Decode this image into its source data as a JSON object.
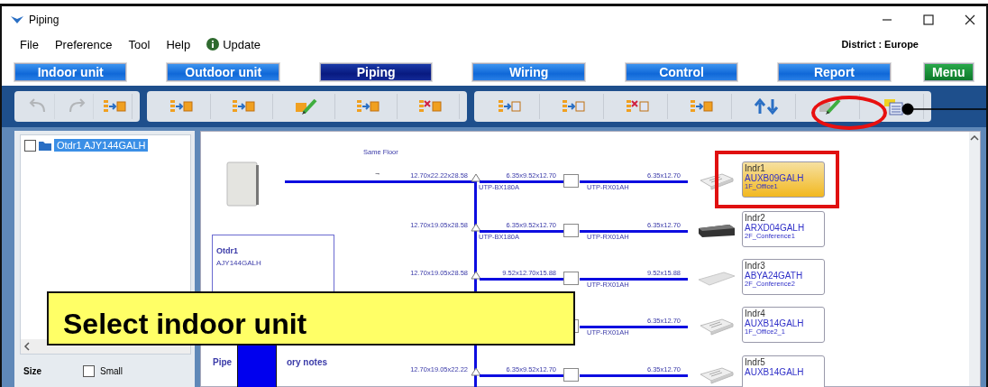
{
  "window": {
    "title": "Piping"
  },
  "menu": [
    "File",
    "Preference",
    "Tool",
    "Help"
  ],
  "update_link": "Update",
  "district": "District : Europe",
  "tabs": [
    {
      "label": "Indoor unit",
      "selected": false,
      "kind": "nav"
    },
    {
      "label": "Outdoor unit",
      "selected": false,
      "kind": "nav"
    },
    {
      "label": "Piping",
      "selected": true,
      "kind": "nav"
    },
    {
      "label": "Wiring",
      "selected": false,
      "kind": "nav"
    },
    {
      "label": "Control",
      "selected": false,
      "kind": "nav"
    },
    {
      "label": "Report",
      "selected": false,
      "kind": "nav"
    },
    {
      "label": "Menu",
      "selected": false,
      "kind": "menu"
    }
  ],
  "toolbar_groups": [
    [
      {
        "kind": "undo",
        "disabled": true
      },
      {
        "kind": "redo",
        "disabled": true
      },
      {
        "kind": "exchange",
        "disabled": false
      }
    ],
    [
      {
        "kind": "add-unit",
        "disabled": false
      },
      {
        "kind": "add-block",
        "disabled": false
      },
      {
        "kind": "edit",
        "disabled": false
      },
      {
        "kind": "swap",
        "disabled": false
      },
      {
        "kind": "delete",
        "disabled": false
      }
    ],
    [
      {
        "kind": "add-list",
        "disabled": false
      },
      {
        "kind": "insert",
        "disabled": false
      },
      {
        "kind": "delete-list",
        "disabled": false
      },
      {
        "kind": "move",
        "disabled": false
      },
      {
        "kind": "up-down",
        "disabled": false
      },
      {
        "kind": "edit-note",
        "disabled": false
      },
      {
        "kind": "list",
        "disabled": false
      }
    ]
  ],
  "tree": [
    {
      "label": "Otdr1 AJY144GALH",
      "checked": false,
      "selected": true
    }
  ],
  "size": {
    "label": "Size",
    "option": "Small",
    "checked": false
  },
  "diagram": {
    "same_floor": "Same Floor",
    "arrow": "→",
    "outdoor": {
      "name": "Otdr1",
      "model": "AJY144GALH"
    },
    "notes": [
      "Pipe",
      "ory notes"
    ],
    "rows": [
      {
        "main": "12.70x22.22x28.58",
        "branch": "6.35x9.52x12.70",
        "joint": "UTP-BX180A",
        "reducer": "UTP-RX01AH",
        "end": "6.35x12.70",
        "unit": {
          "name": "Indr1",
          "model": "AUXB09GALH",
          "room": "1F_Office1",
          "kind": "cassette",
          "selected": true
        }
      },
      {
        "main": "12.70x19.05x28.58",
        "branch": "6.35x9.52x12.70",
        "joint": "UTP-BX180A",
        "reducer": "UTP-RX01AH",
        "end": "6.35x12.70",
        "unit": {
          "name": "Indr2",
          "model": "ARXD04GALH",
          "room": "2F_Conference1",
          "kind": "duct",
          "selected": false
        }
      },
      {
        "main": "12.70x19.05x28.58",
        "branch": "9.52x12.70x15.88",
        "reducer": "UTP-RX01AH",
        "end": "9.52x15.88",
        "unit": {
          "name": "Indr3",
          "model": "ABYA24GATH",
          "room": "2F_Conference2",
          "kind": "ceiling",
          "selected": false
        }
      },
      {
        "reducer": "UTP-RX01AH",
        "end": "6.35x12.70",
        "unit": {
          "name": "Indr4",
          "model": "AUXB14GALH",
          "room": "1F_Office2_1",
          "kind": "cassette",
          "selected": false
        }
      },
      {
        "main": "12.70x19.05x22.22",
        "branch": "6.35x9.52x12.70",
        "end": "6.35x12.70",
        "unit": {
          "name": "Indr5",
          "model": "AUXB14GALH",
          "kind": "cassette",
          "selected": false
        }
      }
    ]
  },
  "callout": "Select indoor unit"
}
